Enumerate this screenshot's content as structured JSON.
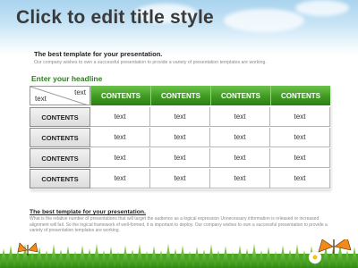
{
  "slide": {
    "title": "Click to edit title style",
    "subtitle": "The best template for your presentation.",
    "subtitle_text": "Our company wishes to own a successful presentation to provide a variety of presentation templates are working.",
    "headline": "Enter your headline"
  },
  "table": {
    "corner_top": "text",
    "corner_bottom": "text",
    "columns": [
      "CONTENTS",
      "CONTENTS",
      "CONTENTS",
      "CONTENTS"
    ],
    "rows": [
      {
        "label": "CONTENTS",
        "cells": [
          "text",
          "text",
          "text",
          "text"
        ]
      },
      {
        "label": "CONTENTS",
        "cells": [
          "text",
          "text",
          "text",
          "text"
        ]
      },
      {
        "label": "CONTENTS",
        "cells": [
          "text",
          "text",
          "text",
          "text"
        ]
      },
      {
        "label": "CONTENTS",
        "cells": [
          "text",
          "text",
          "text",
          "text"
        ]
      }
    ]
  },
  "footer": {
    "title": "The best template for your presentation.",
    "text": "What is the relative number of presentations that will target the audience as a logical expression Unnecessary information is released or increased alignment will fail. So the logical framework of well-formed, it is important to deploy. Our company wishes to own a successful presentation to provide a variety of presentation templates are working."
  },
  "colors": {
    "header_green": "#3f9a22",
    "headline_green": "#2e7d1f",
    "title_gray": "#3a3a3a"
  },
  "decorations": [
    "grass-illustration",
    "butterfly-icon",
    "daisy-icon"
  ]
}
